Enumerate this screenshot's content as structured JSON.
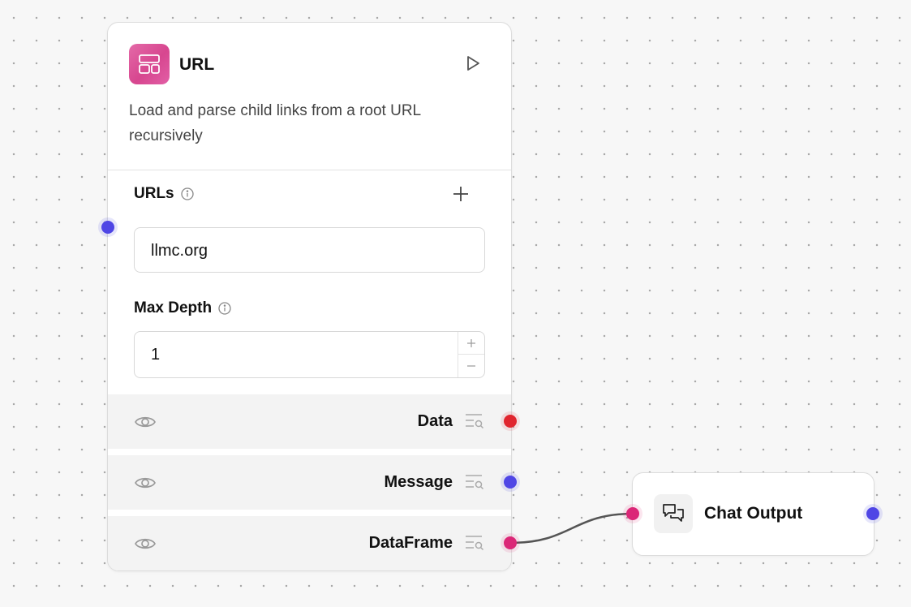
{
  "url_node": {
    "title": "URL",
    "icon": "layout-icon",
    "description": "Load and parse child links from a root URL recursively",
    "fields": {
      "urls": {
        "label": "URLs",
        "value": "llmc.org"
      },
      "max_depth": {
        "label": "Max Depth",
        "value": "1"
      }
    },
    "outputs": [
      {
        "label": "Data",
        "handle_color": "#e0252e"
      },
      {
        "label": "Message",
        "handle_color": "#4f46e5"
      },
      {
        "label": "DataFrame",
        "handle_color": "#db2777"
      }
    ]
  },
  "chat_node": {
    "title": "Chat Output",
    "icon": "chat-bubbles-icon",
    "input_handle_color": "#db2777",
    "output_handle_color": "#4f46e5"
  },
  "colors": {
    "icon_gradient": "#d7468f",
    "edge": "#555555",
    "input_handle": "#4f46e5"
  }
}
